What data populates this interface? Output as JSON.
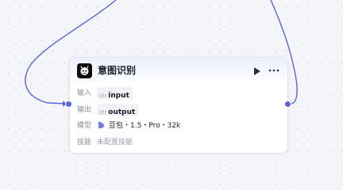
{
  "node": {
    "title": "意图识别",
    "icon": "robot-icon",
    "accent_color": "#5a62e6",
    "rows": {
      "input": {
        "label": "输入",
        "type": "str",
        "name": "input"
      },
      "output": {
        "label": "输出",
        "type": "str",
        "name": "output"
      },
      "model": {
        "label": "模型",
        "value": "豆包・1.5・Pro・32k",
        "icon": "doubao-logo-icon"
      },
      "skills": {
        "label": "技能",
        "value": "未配置技能"
      }
    }
  }
}
